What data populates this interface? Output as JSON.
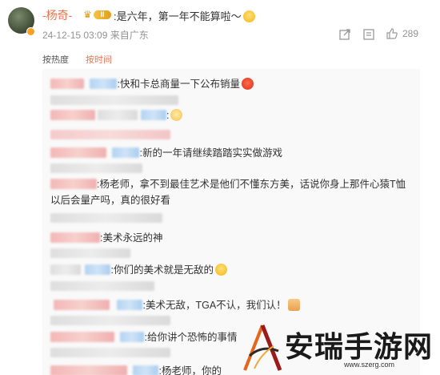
{
  "comment": {
    "username": "-杨奇-",
    "vip_level": "II",
    "text": ":是六年，第一年不能算啦～",
    "timestamp": "24-12-15 03:09",
    "location": "来自广东",
    "like_count": "289"
  },
  "sort": {
    "hot_label": "按热度",
    "time_label": "按时间"
  },
  "replies": [
    {
      "text": ":快和卡总商量一下公布销量"
    },
    {
      "text": ":"
    },
    {
      "text": ":新的一年请继续踏踏实实做游戏"
    },
    {
      "text": ":杨老师，拿不到最佳艺术是他们不懂东方美，话说你身上那件心猿T恤以后会量产吗，真的很好看"
    },
    {
      "text": ":美术永远的神"
    },
    {
      "text": ":你们的美术就是无敌的"
    },
    {
      "text": ":美术无敌，TGA不认，我们认！"
    },
    {
      "text": ":给你讲个恐怖的事情"
    },
    {
      "text": ":杨老师，你的"
    }
  ],
  "watermark": {
    "name": "安瑞手游网",
    "url": "www.szerg.com"
  },
  "colors": {
    "accent": "#eb7350",
    "meta": "#939393",
    "panel_bg": "#f9f9f9"
  }
}
